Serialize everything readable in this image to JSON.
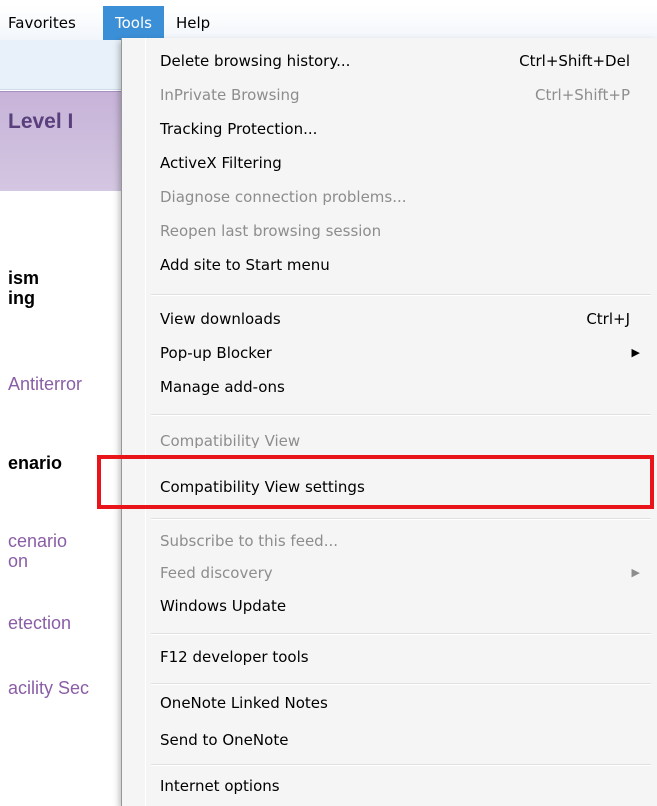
{
  "menubar": {
    "favorites": "Favorites",
    "tools": "Tools",
    "help": "Help"
  },
  "background": {
    "level": "Level I",
    "line1": "ism",
    "line2": "ing",
    "antiterror": "Antiterror",
    "scenario": "enario",
    "cenario1": "cenario",
    "cenario2": "on",
    "detection": "etection",
    "facility": "acility Sec"
  },
  "menu": {
    "items": [
      {
        "label": "Delete browsing history...",
        "shortcut": "Ctrl+Shift+Del",
        "enabled": true
      },
      {
        "label": "InPrivate Browsing",
        "shortcut": "Ctrl+Shift+P",
        "enabled": false
      },
      {
        "label": "Tracking Protection...",
        "shortcut": "",
        "enabled": true
      },
      {
        "label": "ActiveX Filtering",
        "shortcut": "",
        "enabled": true
      },
      {
        "label": "Diagnose connection problems...",
        "shortcut": "",
        "enabled": false
      },
      {
        "label": "Reopen last browsing session",
        "shortcut": "",
        "enabled": false
      },
      {
        "label": "Add site to Start menu",
        "shortcut": "",
        "enabled": true
      },
      {
        "label": "View downloads",
        "shortcut": "Ctrl+J",
        "enabled": true
      },
      {
        "label": "Pop-up Blocker",
        "shortcut": "",
        "enabled": true,
        "submenu": true
      },
      {
        "label": "Manage add-ons",
        "shortcut": "",
        "enabled": true
      },
      {
        "label": "Compatibility View",
        "shortcut": "",
        "enabled": false
      },
      {
        "label": "Compatibility View settings",
        "shortcut": "",
        "enabled": true
      },
      {
        "label": "Subscribe to this feed...",
        "shortcut": "",
        "enabled": false
      },
      {
        "label": "Feed discovery",
        "shortcut": "",
        "enabled": false,
        "submenu": true
      },
      {
        "label": "Windows Update",
        "shortcut": "",
        "enabled": true
      },
      {
        "label": "F12 developer tools",
        "shortcut": "",
        "enabled": true
      },
      {
        "label": "OneNote Linked Notes",
        "shortcut": "",
        "enabled": true
      },
      {
        "label": "Send to OneNote",
        "shortcut": "",
        "enabled": true
      },
      {
        "label": "Internet options",
        "shortcut": "",
        "enabled": true
      }
    ],
    "submenu_arrow": "▶"
  },
  "colors": {
    "highlight": "#e8141a",
    "menubar_active": "#3b8fd6",
    "disabled_text": "#8d8d8d"
  }
}
